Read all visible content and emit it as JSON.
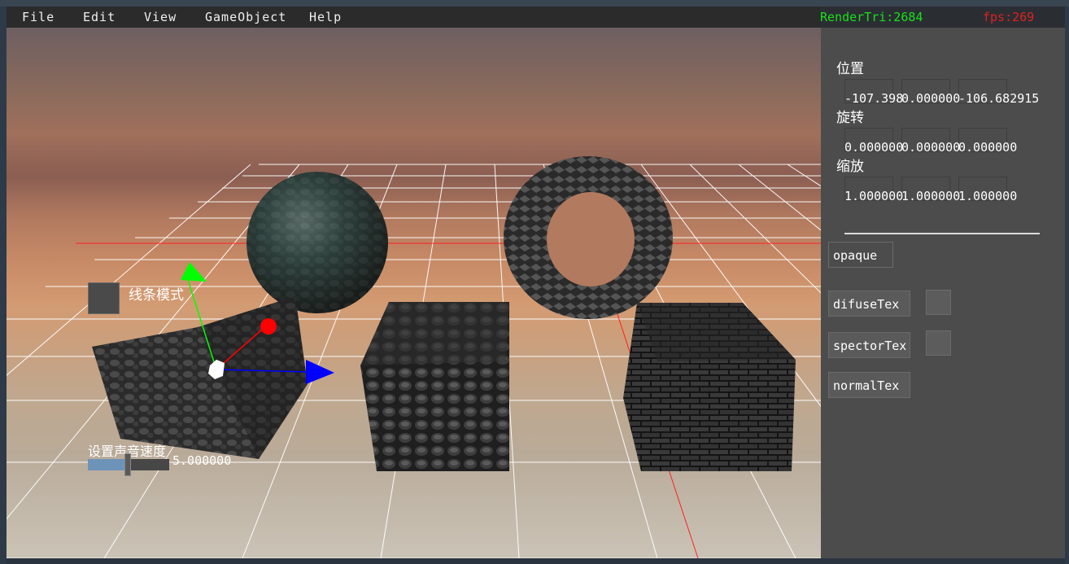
{
  "menu": {
    "items": [
      "File",
      "Edit",
      "View",
      "GameObject",
      "Help"
    ]
  },
  "stats": {
    "render_tri": "RenderTri:2684",
    "fps": "fps:269"
  },
  "inspector": {
    "position_label": "位置",
    "position_values": [
      "-107.398",
      "0.000000",
      "-106.682915"
    ],
    "rotation_label": "旋转",
    "rotation_values": [
      "0.000000",
      "0.000000",
      "0.000000"
    ],
    "scale_label": "缩放",
    "scale_values": [
      "1.000000",
      "1.000000",
      "1.000000"
    ],
    "render_mode_button": "opaque",
    "diffuse_tex_button": "difuseTex",
    "specular_tex_button": "spectorTex",
    "normal_tex_button": "normalTex"
  },
  "overlay": {
    "wireframe_label": "线条模式",
    "sound_speed_label": "设置声音速度",
    "sound_speed_value": "5.000000",
    "sound_speed_fraction": 0.5
  },
  "colors": {
    "render_tri": "#19e019",
    "fps": "#e02020",
    "panel_bg": "#4c4c4c",
    "gizmo_x": "#0000ff",
    "gizmo_y": "#00ff00",
    "gizmo_z": "#ff0000"
  },
  "icons": {
    "gizmo": "transform-gizmo-icon"
  }
}
